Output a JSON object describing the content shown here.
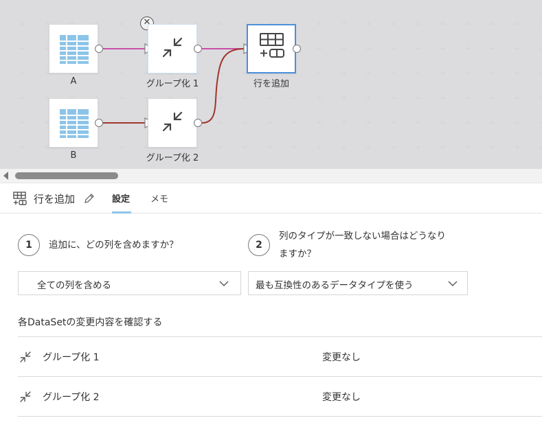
{
  "canvas": {
    "nodes": [
      {
        "id": "A",
        "label": "A",
        "icon": "table-icon"
      },
      {
        "id": "B",
        "label": "B",
        "icon": "table-icon"
      },
      {
        "id": "g1",
        "label": "グループ化 1",
        "icon": "collapse-arrows-icon"
      },
      {
        "id": "g2",
        "label": "グループ化 2",
        "icon": "collapse-arrows-icon"
      },
      {
        "id": "add",
        "label": "行を追加",
        "icon": "add-rows-icon"
      }
    ],
    "colors": {
      "wire_pink": "#c94fa8",
      "wire_red": "#a0342a",
      "selected_border": "#4a90d9",
      "table_blue": "#8cc4e8"
    }
  },
  "panel": {
    "title": "行を追加",
    "tabs": [
      {
        "label": "設定",
        "active": true
      },
      {
        "label": "メモ",
        "active": false
      }
    ],
    "step1": {
      "number": "1",
      "question": "追加に、どの列を含めますか？",
      "selected": "全ての列を含める"
    },
    "step2": {
      "number": "2",
      "question_line1": "列のタイプが一致しない場合はどうなり",
      "question_line2": "ますか？",
      "selected": "最も互換性のあるデータタイプを使う"
    },
    "section_title": "各DataSetの変更内容を確認する",
    "rows": [
      {
        "name": "グループ化 1",
        "status": "変更なし"
      },
      {
        "name": "グループ化 2",
        "status": "変更なし"
      }
    ]
  }
}
